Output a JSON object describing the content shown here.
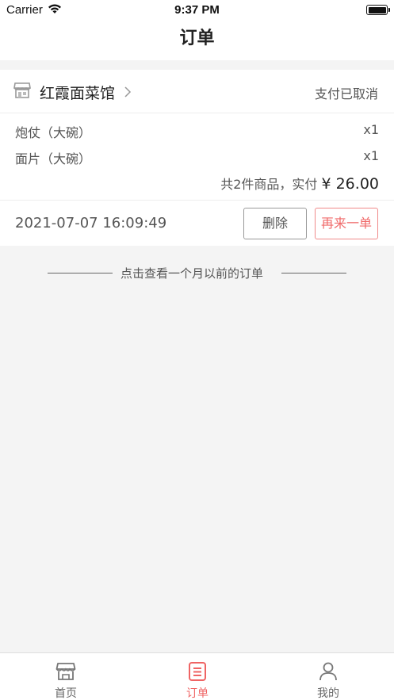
{
  "status_bar": {
    "carrier": "Carrier",
    "time": "9:37 PM"
  },
  "nav": {
    "title": "订单"
  },
  "order": {
    "shop_name": "红霞面菜馆",
    "status": "支付已取消",
    "items": [
      {
        "name": "炮仗（大碗）",
        "qty": "x1"
      },
      {
        "name": "面片（大碗）",
        "qty": "x1"
      }
    ],
    "summary_text": "共2件商品，实付",
    "total": "¥ 26.00",
    "time": "2021-07-07 16:09:49",
    "delete_label": "删除",
    "reorder_label": "再来一单"
  },
  "history": {
    "link_text": "点击查看一个月以前的订单"
  },
  "tabs": [
    {
      "label": "首页",
      "icon": "store-icon",
      "active": false
    },
    {
      "label": "订单",
      "icon": "order-list-icon",
      "active": true
    },
    {
      "label": "我的",
      "icon": "user-icon",
      "active": false
    }
  ],
  "colors": {
    "accent": "#ef6464",
    "background": "#f4f4f4"
  }
}
